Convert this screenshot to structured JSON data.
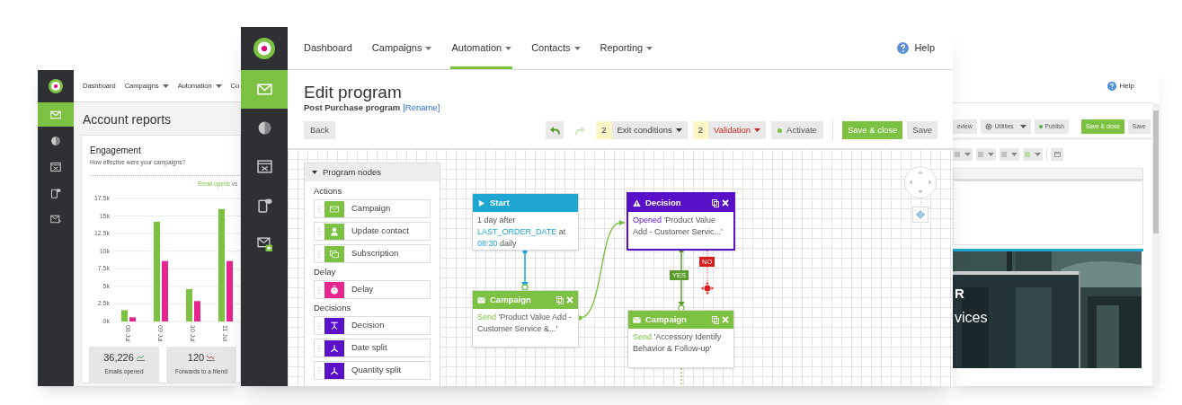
{
  "left_window": {
    "sidebar": [
      {
        "kind": "email",
        "selected": true
      },
      {
        "kind": "reports",
        "selected": false
      },
      {
        "kind": "automation",
        "selected": false
      },
      {
        "kind": "mobile",
        "selected": false
      },
      {
        "kind": "transactional",
        "selected": false
      }
    ],
    "nav": [
      {
        "label": "Dashboard",
        "dropdown": false
      },
      {
        "label": "Campaigns",
        "dropdown": true
      },
      {
        "label": "Automation",
        "dropdown": true
      },
      {
        "label": "Co",
        "dropdown": false
      }
    ],
    "title": "Account reports",
    "card": {
      "title": "Engagement",
      "subtitle": "How effective were your campaigns?",
      "legend_joiner": "vs",
      "chart_data": {
        "type": "bar",
        "categories": [
          "08 Jul",
          "09 Jul",
          "10 Jul",
          "11 Jul"
        ],
        "series": [
          {
            "name": "Email opens",
            "color": "#7cc142",
            "values": [
              1600,
              14200,
              4600,
              16000
            ]
          },
          {
            "color": "#e6268c",
            "values": [
              600,
              8600,
              2900,
              8600
            ]
          }
        ],
        "ylim": [
          0,
          17500
        ],
        "grid": true,
        "yticks": [
          {
            "value": 0,
            "label": "0k"
          },
          {
            "value": 2500,
            "label": "2.5k"
          },
          {
            "value": 5000,
            "label": "5k"
          },
          {
            "value": 7500,
            "label": "7.5k"
          },
          {
            "value": 10000,
            "label": "10k"
          },
          {
            "value": 12500,
            "label": "12.5k"
          },
          {
            "value": 15000,
            "label": "15k"
          },
          {
            "value": 17500,
            "label": "17.5k"
          }
        ]
      }
    },
    "stats": [
      {
        "value": "36,226",
        "kind": "up",
        "label": "Emails opened"
      },
      {
        "value": "120",
        "kind": "down",
        "label": "Forwards to a friend"
      }
    ]
  },
  "main_window": {
    "sidebar": [
      {
        "kind": "email",
        "selected": true
      },
      {
        "kind": "reports",
        "selected": false
      },
      {
        "kind": "automation",
        "selected": false
      },
      {
        "kind": "mobile",
        "selected": false
      },
      {
        "kind": "add_email",
        "selected": false
      }
    ],
    "nav": [
      {
        "label": "Dashboard",
        "dropdown": false,
        "selected": false
      },
      {
        "label": "Campaigns",
        "dropdown": true,
        "selected": false
      },
      {
        "label": "Automation",
        "dropdown": true,
        "selected": true
      },
      {
        "label": "Contacts",
        "dropdown": true,
        "selected": false
      },
      {
        "label": "Reporting",
        "dropdown": true,
        "selected": false
      }
    ],
    "help": "Help",
    "title": "Edit program",
    "program_name": "Post Purchase program",
    "rename": "[Rename]",
    "toolbar": {
      "back": "Back",
      "history": [
        {
          "kind": "undo",
          "disabled": false
        },
        {
          "kind": "redo",
          "disabled": true
        }
      ],
      "exit_conditions": {
        "count": "2",
        "label": "Exit conditions"
      },
      "validation": {
        "count": "2",
        "label": "Validation"
      },
      "activate": "Activate",
      "save_close": "Save & close",
      "save": "Save"
    },
    "palette": {
      "title": "Program nodes",
      "expanded": true,
      "sections": [
        {
          "title": "Actions",
          "items": [
            {
              "label": "Campaign",
              "kind": "campaign"
            },
            {
              "label": "Update contact",
              "kind": "update_contact"
            },
            {
              "label": "Subscription",
              "kind": "subscription"
            }
          ]
        },
        {
          "title": "Delay",
          "items": [
            {
              "label": "Delay",
              "kind": "delay"
            }
          ]
        },
        {
          "title": "Decisions",
          "items": [
            {
              "label": "Decision",
              "kind": "decision"
            },
            {
              "label": "Date split",
              "kind": "date_split"
            },
            {
              "label": "Quantity split",
              "kind": "quantity_split"
            }
          ]
        }
      ]
    },
    "nodes": [
      {
        "kind": "start",
        "title": "Start",
        "selected": false,
        "actions": false,
        "body": [
          {
            "text": "1 day after ",
            "kind": "plain"
          },
          {
            "text": "LAST_ORDER_DATE",
            "kind": "field"
          },
          {
            "text": " at ",
            "kind": "plain"
          },
          {
            "text": "08:30",
            "kind": "field"
          },
          {
            "text": " daily",
            "kind": "plain"
          }
        ]
      },
      {
        "kind": "campaign",
        "title": "Campaign",
        "selected": false,
        "actions": true,
        "body": [
          {
            "text": "Send",
            "kind": "verb"
          },
          {
            "text": " 'Product Value Add - Customer Service &...'",
            "kind": "plain"
          }
        ]
      },
      {
        "kind": "decision",
        "title": "Decision",
        "selected": true,
        "actions": true,
        "body": [
          {
            "text": "Opened",
            "kind": "verb"
          },
          {
            "text": " 'Product Value Add - Customer Servic...'",
            "kind": "plain"
          }
        ]
      },
      {
        "kind": "campaign",
        "title": "Campaign",
        "selected": false,
        "actions": true,
        "body": [
          {
            "text": "Send",
            "kind": "verb"
          },
          {
            "text": " 'Accessory Identify Behavior & Follow-up'",
            "kind": "plain"
          }
        ]
      }
    ],
    "branches": [
      {
        "label": "YES",
        "kind": "yes"
      },
      {
        "label": "NO",
        "kind": "no"
      }
    ]
  },
  "right_window": {
    "help": "Help",
    "toolbar": [
      {
        "label": "eview",
        "kind": "plain"
      },
      {
        "label": "Utilities",
        "kind": "menu"
      },
      {
        "label": "Publish",
        "kind": "status"
      },
      {
        "label": "Save & close",
        "kind": "primary"
      },
      {
        "label": "Save",
        "kind": "plain"
      }
    ],
    "hero_text": [
      "R",
      "vices"
    ]
  }
}
